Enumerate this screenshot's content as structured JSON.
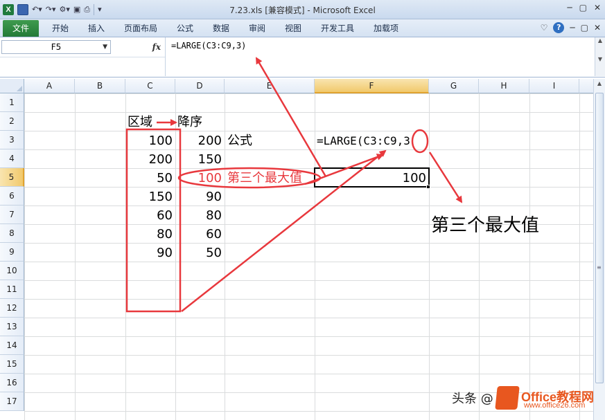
{
  "window": {
    "title": "7.23.xls  [兼容模式] - Microsoft Excel",
    "app_icon": "X",
    "controls": [
      "─",
      "▢",
      "✕"
    ]
  },
  "ribbon": {
    "file_tab": "文件",
    "tabs": [
      "开始",
      "插入",
      "页面布局",
      "公式",
      "数据",
      "审阅",
      "视图",
      "开发工具",
      "加载项"
    ],
    "right_controls": [
      "♡",
      "?",
      "─",
      "▢",
      "✕"
    ]
  },
  "formula_bar": {
    "name_box": "F5",
    "fx": "fx",
    "formula": "=LARGE(C3:C9,3)"
  },
  "grid": {
    "columns": [
      "A",
      "B",
      "C",
      "D",
      "E",
      "F",
      "G",
      "H",
      "I"
    ],
    "selected_column": "F",
    "rows": [
      "1",
      "2",
      "3",
      "4",
      "5",
      "6",
      "7",
      "8",
      "9",
      "10",
      "11",
      "12",
      "13",
      "14",
      "15",
      "16",
      "17"
    ],
    "selected_row": "5",
    "header_region": "区域",
    "header_desc": "降序",
    "label_formula": "公式",
    "label_third": "第三个最大值",
    "f3_formula": "=LARGE(C3:C9,3",
    "col_c_values": [
      "100",
      "200",
      "50",
      "150",
      "60",
      "80",
      "90"
    ],
    "col_d_values": [
      "200",
      "150",
      "100",
      "90",
      "80",
      "60",
      "50"
    ],
    "f5_value": "100"
  },
  "annotation": {
    "big_label": "第三个最大值",
    "colors": {
      "red": "#e8383d",
      "excel_green": "#237a37",
      "brand_orange": "#e8571f"
    }
  },
  "watermark": {
    "text": "头条 @",
    "brand": "Office教程网",
    "url": "www.office26.com"
  }
}
